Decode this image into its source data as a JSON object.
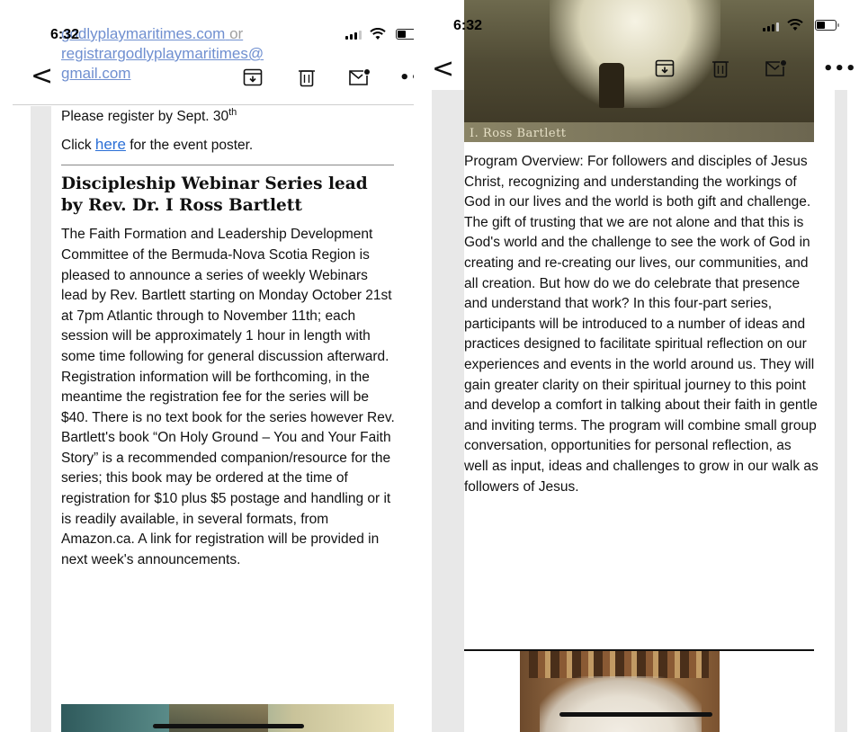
{
  "left": {
    "status": {
      "time": "6:32"
    },
    "faded_header": {
      "line1_link": "godlyplaymaritimes.com",
      "line1_suffix": "or",
      "line2": "registrargodlyplaymaritimes@",
      "line3": "gmail.com"
    },
    "toolbar": {
      "back_glyph": "<",
      "more_glyph": "••"
    },
    "register_prefix": "Please register by Sept. 30",
    "register_sup": "th",
    "click_prefix": "Click ",
    "click_link": "here",
    "click_suffix": " for the event poster.",
    "heading": "Discipleship Webinar Series lead by Rev. Dr. I Ross Bartlett",
    "paragraph": "The Faith Formation and Leadership Development Committee of the Bermuda-Nova Scotia Region is pleased to announce a series of weekly Webinars lead by Rev. Bartlett starting on Monday October 21st at 7pm Atlantic through to November 11th; each session will be approximately 1 hour in length with some time following for general discussion afterward. Registration information will be forthcoming, in the meantime the registration fee for the series will be $40. There is no text book for the series however Rev. Bartlett's book “On Holy Ground – You and Your Faith Story” is a recommended companion/resource for the series; this book may be ordered at the time of registration for $10 plus $5 postage and handling or it is readily available, in several formats, from Amazon.ca. A link for registration will be provided in next week's announcements."
  },
  "right": {
    "status": {
      "time": "6:32"
    },
    "toolbar": {
      "back_glyph": "<",
      "more_glyph": "•••"
    },
    "image_caption": "I. Ross Bartlett",
    "paragraph": "Program Overview: For followers and disciples of Jesus Christ, recognizing and understanding the workings of God in our lives and the world is both gift and challenge. The gift of trusting that we are not alone and that this is God's world and the challenge to see the work of God in creating and re-creating our lives, our communities, and all creation. But how do we do celebrate that presence and understand that work? In this four-part series, participants will be introduced to a number of ideas and practices designed to facilitate spiritual reflection on our experiences and events in the world around us. They will gain greater clarity on their spiritual journey to this point and develop a comfort in talking about their faith in gentle and inviting terms. The program will combine small group conversation, opportunities for personal reflection, as well as input, ideas and challenges to grow in our walk as followers of Jesus."
  },
  "icons": [
    "back-chevron-icon",
    "archive-icon",
    "trash-icon",
    "mail-unread-icon",
    "more-icon",
    "signal-icon",
    "wifi-icon",
    "battery-icon"
  ],
  "colors": {
    "link": "#2b6fd6",
    "faded_link": "#6f8fd0",
    "gutter": "#e8e8e8"
  }
}
